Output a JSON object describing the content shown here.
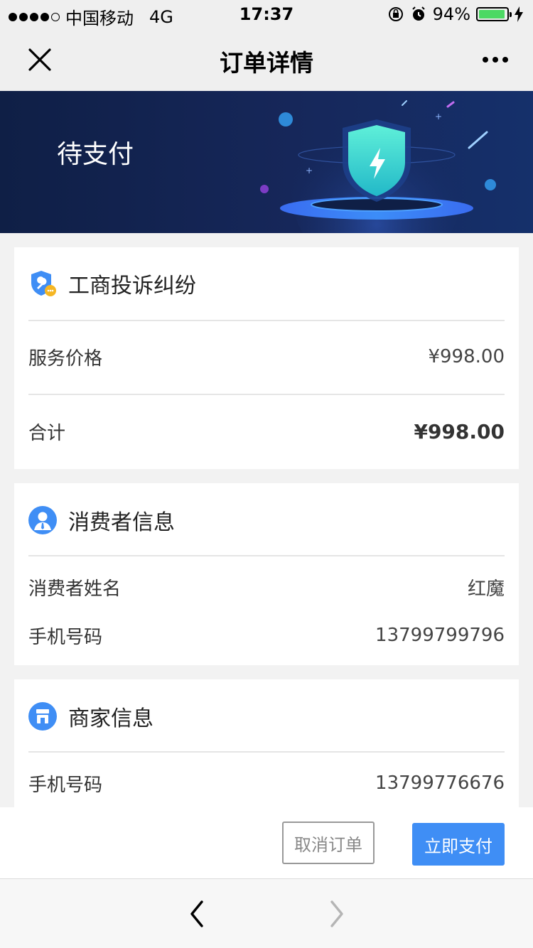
{
  "status_bar": {
    "carrier": "中国移动",
    "network": "4G",
    "time": "17:37",
    "battery_percent": "94%",
    "battery_level": 0.94
  },
  "nav": {
    "title": "订单详情"
  },
  "banner": {
    "status": "待支付"
  },
  "service_card": {
    "title": "工商投诉纠纷",
    "price_label": "服务价格",
    "price_value": "¥998.00",
    "total_label": "合计",
    "total_value": "¥998.00"
  },
  "consumer_card": {
    "title": "消费者信息",
    "name_label": "消费者姓名",
    "name_value": "红魔",
    "phone_label": "手机号码",
    "phone_value": "13799799796"
  },
  "merchant_card": {
    "title": "商家信息",
    "phone_label": "手机号码",
    "phone_value": "13799776676"
  },
  "actions": {
    "cancel_label": "取消订单",
    "pay_label": "立即支付"
  },
  "colors": {
    "accent": "#3f8ef5",
    "banner_bg": "#0f1f46",
    "shield": "#3de0c8",
    "battery": "#4cd964"
  },
  "icons": {
    "close": "close-icon",
    "more": "more-icon",
    "service": "shield-wrench-icon",
    "consumer": "user-icon",
    "merchant": "shop-icon",
    "back": "chevron-left-icon",
    "forward": "chevron-right-icon"
  }
}
